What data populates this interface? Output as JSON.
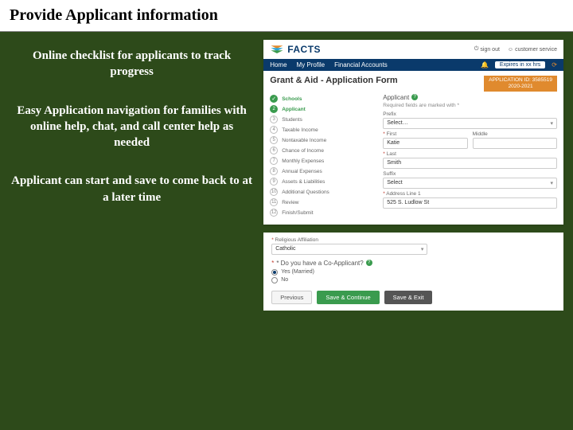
{
  "slide": {
    "title": "Provide Applicant information",
    "bullets": [
      "Online checklist for applicants to track progress",
      "Easy Application navigation for families with online help, chat, and call center help as needed",
      "Applicant can start and save to come back to at a later time"
    ]
  },
  "app1": {
    "logo": "FACTS",
    "top_links": {
      "signout": "sign out",
      "service": "customer service"
    },
    "nav": {
      "home": "Home",
      "profile": "My Profile",
      "accounts": "Financial Accounts",
      "expires": "Expires in xx hrs"
    },
    "form_title": "Grant & Aid - Application Form",
    "app_id": {
      "line1": "APPLICATION ID: 3585519",
      "line2": "2020-2021"
    },
    "steps": [
      {
        "num": "",
        "label": "Schools",
        "state": "done"
      },
      {
        "num": "2",
        "label": "Applicant",
        "state": "active"
      },
      {
        "num": "3",
        "label": "Students",
        "state": ""
      },
      {
        "num": "4",
        "label": "Taxable Income",
        "state": ""
      },
      {
        "num": "5",
        "label": "Nontaxable Income",
        "state": ""
      },
      {
        "num": "6",
        "label": "Chance of Income",
        "state": ""
      },
      {
        "num": "7",
        "label": "Monthly Expenses",
        "state": ""
      },
      {
        "num": "8",
        "label": "Annual Expenses",
        "state": ""
      },
      {
        "num": "9",
        "label": "Assets & Liabilities",
        "state": ""
      },
      {
        "num": "10",
        "label": "Additional Questions",
        "state": ""
      },
      {
        "num": "11",
        "label": "Review",
        "state": ""
      },
      {
        "num": "12",
        "label": "Finish/Submit",
        "state": ""
      }
    ],
    "section": "Applicant",
    "req_note": "Required fields are marked with *",
    "fields": {
      "prefix_label": "Prefix",
      "prefix_value": "Select…",
      "first_label": "* First",
      "first_value": "Katie",
      "middle_label": "Middle",
      "middle_value": "",
      "last_label": "* Last",
      "last_value": "Smith",
      "suffix_label": "Suffix",
      "suffix_value": "Select",
      "addr_label": "* Address Line 1",
      "addr_value": "525 S. Ludlow St"
    }
  },
  "app2": {
    "relaff_label": "* Religious Affiliation",
    "relaff_value": "Catholic",
    "coapp_label": "* Do you have a Co-Applicant?",
    "opt_yes": "Yes (Married)",
    "opt_no": "No",
    "btn_prev": "Previous",
    "btn_save_cont": "Save & Continue",
    "btn_save_exit": "Save & Exit"
  }
}
